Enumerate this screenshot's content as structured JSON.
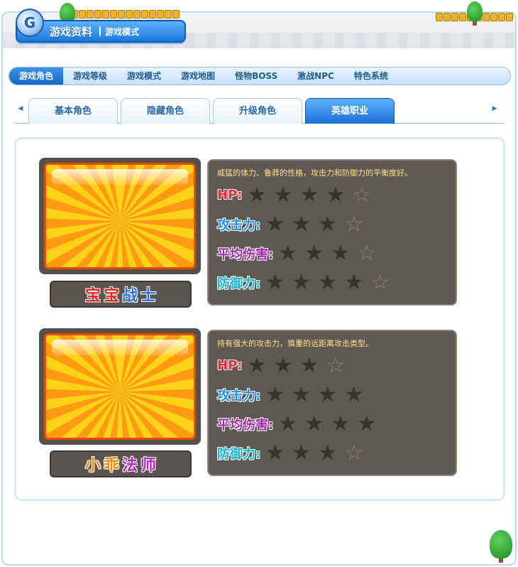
{
  "header": {
    "title": "游戏资料",
    "subtitle": "游戏模式"
  },
  "main_nav": [
    {
      "label": "游戏角色",
      "active": true
    },
    {
      "label": "游戏等级",
      "active": false
    },
    {
      "label": "游戏模式",
      "active": false
    },
    {
      "label": "游戏地图",
      "active": false
    },
    {
      "label": "怪物BOSS",
      "active": false
    },
    {
      "label": "激战NPC",
      "active": false
    },
    {
      "label": "特色系统",
      "active": false
    }
  ],
  "sub_tabs": [
    {
      "label": "基本角色",
      "active": false
    },
    {
      "label": "隐藏角色",
      "active": false
    },
    {
      "label": "升级角色",
      "active": false
    },
    {
      "label": "英雄职业",
      "active": true
    }
  ],
  "characters": [
    {
      "name_chars": [
        {
          "ch": "宝",
          "color": "#e0282a"
        },
        {
          "ch": "宝",
          "color": "#e0282a"
        },
        {
          "ch": "战",
          "color": "#2f6fd8"
        },
        {
          "ch": "士",
          "color": "#2f6fd8"
        }
      ],
      "description": "威猛的体力、鲁莽的性格，攻击力和防御力的平衡度好。",
      "stats": [
        {
          "label": "HP:",
          "color": "#e8283a",
          "filled": 4,
          "total": 5
        },
        {
          "label": "攻击力:",
          "color": "#1e8fe6",
          "filled": 3,
          "total": 4
        },
        {
          "label": "平均伤害:",
          "color": "#a02aa8",
          "filled": 3,
          "total": 4
        },
        {
          "label": "防御力:",
          "color": "#15b5d8",
          "filled": 4,
          "total": 5
        }
      ]
    },
    {
      "name_chars": [
        {
          "ch": "小",
          "color": "#f08a10"
        },
        {
          "ch": "乖",
          "color": "#f08a10"
        },
        {
          "ch": "法",
          "color": "#b02ab8"
        },
        {
          "ch": "师",
          "color": "#b02ab8"
        }
      ],
      "description": "持有强大的攻击力，慎重的远距离攻击类型。",
      "stats": [
        {
          "label": "HP:",
          "color": "#e8283a",
          "filled": 3,
          "total": 4
        },
        {
          "label": "攻击力:",
          "color": "#1e8fe6",
          "filled": 4,
          "total": 4
        },
        {
          "label": "平均伤害:",
          "color": "#a02aa8",
          "filled": 4,
          "total": 4
        },
        {
          "label": "防御力:",
          "color": "#15b5d8",
          "filled": 3,
          "total": 4
        }
      ]
    }
  ]
}
